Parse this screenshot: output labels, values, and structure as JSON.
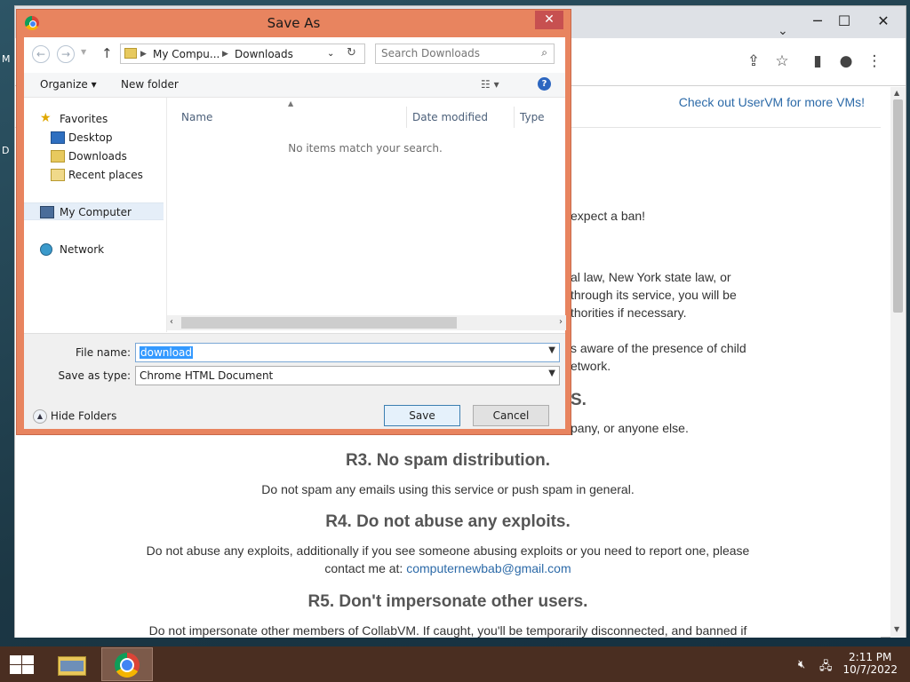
{
  "desktop": {
    "icon_letters": [
      "M",
      "D"
    ]
  },
  "browser": {
    "window_controls": {
      "minimize": "─",
      "maximize": "☐",
      "close": "✕"
    },
    "tab_dropdown": "⌄",
    "toolbar_icons": {
      "share": "⇪",
      "bookmark": "☆",
      "sidebar": "▮",
      "profile": "●",
      "menu": "⋮"
    }
  },
  "page": {
    "header_link": "Check out UserVM for more VMs!",
    "partial_lines": [
      "expect a ban!",
      "al law, New York state law, or",
      "through its service, you will be",
      "thorities if necessary.",
      "s aware of the presence of child",
      "etwork.",
      "S.",
      "pany, or anyone else."
    ],
    "r3_heading": "R3. No spam distribution.",
    "r3_text": "Do not spam any emails using this service or push spam in general.",
    "r4_heading": "R4. Do not abuse any exploits.",
    "r4_text_1": "Do not abuse any exploits, additionally if you see someone abusing exploits or you need to report one, please",
    "r4_text_2_prefix": "contact me at: ",
    "r4_email": "computernewbab@gmail.com",
    "r5_heading": "R5. Don't impersonate other users.",
    "r5_text": "Do not impersonate other members of CollabVM. If caught, you'll be temporarily disconnected, and banned if"
  },
  "dialog": {
    "title": "Save As",
    "close": "✕",
    "nav": {
      "back": "←",
      "forward": "→",
      "up": "↑"
    },
    "breadcrumb": [
      "My Compu...",
      "Downloads"
    ],
    "search_placeholder": "Search Downloads",
    "organize": "Organize ▾",
    "new_folder": "New folder",
    "help": "?",
    "nav_pane": {
      "favorites": "Favorites",
      "desktop": "Desktop",
      "downloads": "Downloads",
      "recent_places": "Recent places",
      "my_computer": "My Computer",
      "network": "Network"
    },
    "columns": {
      "name": "Name",
      "date_modified": "Date modified",
      "type": "Type"
    },
    "empty_message": "No items match your search.",
    "file_name_label": "File name:",
    "file_name_value": "download",
    "save_as_type_label": "Save as type:",
    "save_as_type_value": "Chrome HTML Document",
    "hide_folders": "Hide Folders",
    "save": "Save",
    "cancel": "Cancel"
  },
  "taskbar": {
    "time": "2:11 PM",
    "date": "10/7/2022"
  }
}
